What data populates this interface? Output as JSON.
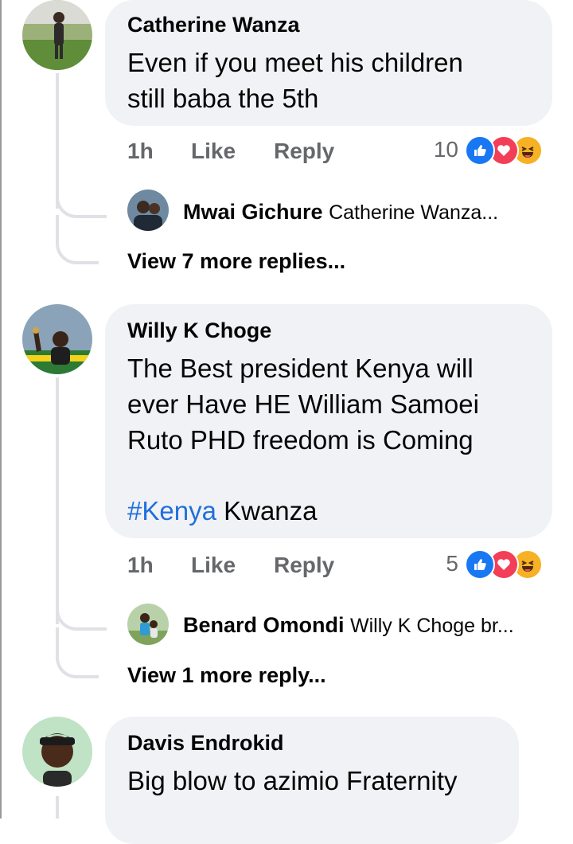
{
  "comments": [
    {
      "author": "Catherine Wanza",
      "text": "Even if you meet his children\nstill baba the 5th",
      "time": "1h",
      "like_label": "Like",
      "reply_label": "Reply",
      "reaction_count": "10",
      "reactions": [
        "like-icon",
        "love-icon",
        "haha-icon"
      ],
      "reply_preview": {
        "name": "Mwai Gichure",
        "snippet": "Catherine Wanza..."
      },
      "view_more": "View 7 more replies..."
    },
    {
      "author": "Willy K Choge",
      "text": "The Best president Kenya will\never Have HE William Samoei\nRuto PHD freedom is Coming",
      "hashtag": "#Kenya",
      "hashtag_tail": " Kwanza",
      "time": "1h",
      "like_label": "Like",
      "reply_label": "Reply",
      "reaction_count": "5",
      "reactions": [
        "like-icon",
        "love-icon",
        "haha-icon"
      ],
      "reply_preview": {
        "name": "Benard Omondi",
        "snippet": "Willy K Choge br..."
      },
      "view_more": "View 1 more reply..."
    },
    {
      "author": "Davis Endrokid",
      "text": "Big blow to azimio Fraternity"
    }
  ],
  "colors": {
    "bubble": "#f0f2f5",
    "meta": "#65676b",
    "hashtag": "#216fdb",
    "like": "#1877f2",
    "love": "#f33e58",
    "haha": "#f7b125"
  }
}
